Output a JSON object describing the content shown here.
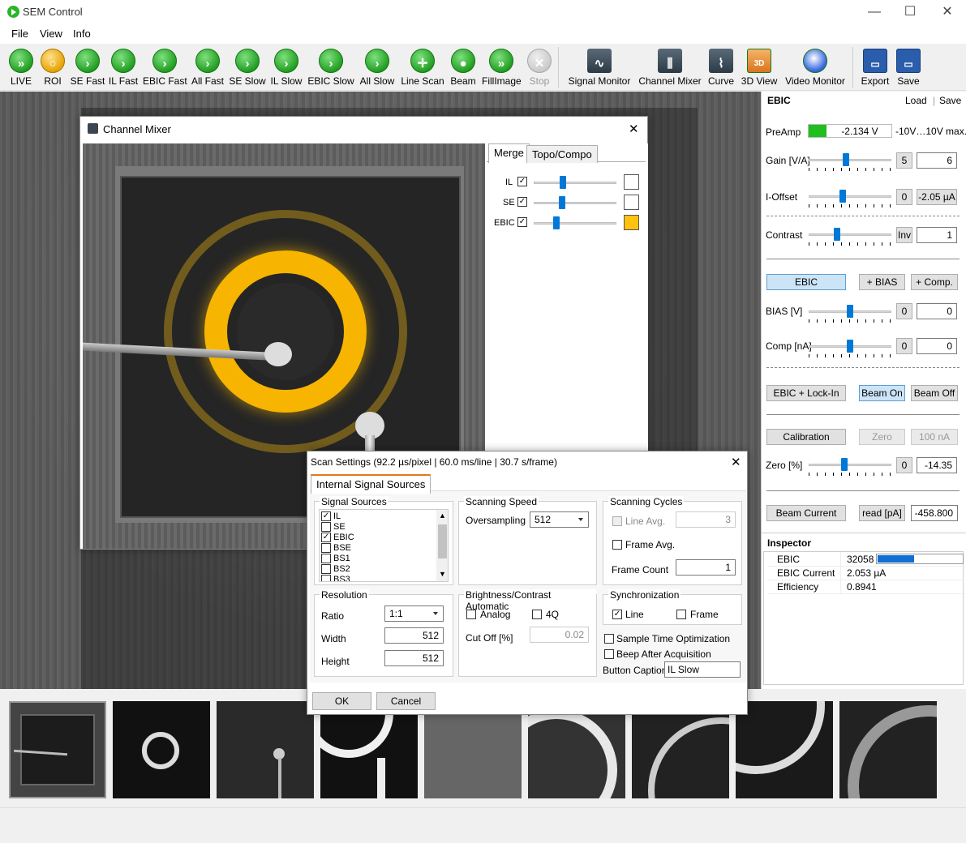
{
  "window": {
    "title": "SEM Control",
    "minimize": "—",
    "maximize": "☐",
    "close": "✕"
  },
  "menu": [
    "File",
    "View",
    "Info"
  ],
  "toolbar": {
    "run": [
      {
        "label": "LIVE",
        "icon": "live-icon"
      },
      {
        "label": "ROI",
        "icon": "roi-magnifier-icon"
      },
      {
        "label": "SE Fast",
        "icon": "play-icon"
      },
      {
        "label": "IL Fast",
        "icon": "play-icon"
      },
      {
        "label": "EBIC Fast",
        "icon": "play-icon"
      },
      {
        "label": "All Fast",
        "icon": "play-icon"
      },
      {
        "label": "SE Slow",
        "icon": "play-icon"
      },
      {
        "label": "IL Slow",
        "icon": "play-icon"
      },
      {
        "label": "EBIC Slow",
        "icon": "play-icon"
      },
      {
        "label": "All Slow",
        "icon": "play-icon"
      },
      {
        "label": "Line Scan",
        "icon": "line-scan-icon"
      },
      {
        "label": "Beam",
        "icon": "beam-icon"
      },
      {
        "label": "FillImage",
        "icon": "fill-image-icon"
      },
      {
        "label": "Stop",
        "icon": "stop-icon"
      }
    ],
    "tools": [
      {
        "label": "Signal Monitor",
        "icon": "signal-monitor-icon"
      },
      {
        "label": "Channel Mixer",
        "icon": "channel-mixer-icon"
      },
      {
        "label": "Curve",
        "icon": "curve-icon"
      },
      {
        "label": "3D View",
        "icon": "3d-view-icon"
      },
      {
        "label": "Video Monitor",
        "icon": "video-monitor-icon"
      }
    ],
    "file": [
      {
        "label": "Export",
        "icon": "floppy-disk-icon"
      },
      {
        "label": "Save",
        "icon": "floppy-disk-icon"
      }
    ]
  },
  "ebic_panel": {
    "title": "EBIC",
    "load": "Load",
    "save": "Save",
    "preamp_label": "PreAmp",
    "preamp_value": "-2.134 V",
    "preamp_range": "-10V…10V max.",
    "gain_label": "Gain [V/A]",
    "gain_step": "5",
    "gain_value": "6",
    "ioffset_label": "I-Offset",
    "ioffset_step": "0",
    "ioffset_value": "-2.05 µA",
    "contrast_label": "Contrast",
    "contrast_inv": "Inv",
    "contrast_value": "1",
    "btn_ebic": "EBIC",
    "btn_bias": "+ BIAS",
    "btn_comp": "+ Comp.",
    "bias_label": "BIAS [V]",
    "bias_step": "0",
    "bias_value": "0",
    "comp_label": "Comp [nA]",
    "comp_step": "0",
    "comp_value": "0",
    "btn_lockin": "EBIC + Lock-In",
    "btn_beam_on": "Beam On",
    "btn_beam_off": "Beam Off",
    "btn_calibration": "Calibration",
    "btn_zero": "Zero",
    "btn_100na": "100 nA",
    "zero_label": "Zero [%]",
    "zero_step": "0",
    "zero_value": "-14.35",
    "btn_beam_current": "Beam Current",
    "btn_read": "read [pA]",
    "beam_current_value": "-458.800"
  },
  "inspector": {
    "title": "Inspector",
    "rows": [
      {
        "name": "EBIC",
        "value": "32058",
        "bar": 0.4
      },
      {
        "name": "EBIC Current",
        "value": "2.053 µA"
      },
      {
        "name": "Efficiency",
        "value": "0.8941"
      }
    ]
  },
  "channel_mixer": {
    "title": "Channel Mixer",
    "close": "✕",
    "tabs": [
      "Merge",
      "Topo/Compo"
    ],
    "channels": [
      {
        "name": "IL",
        "checked": true,
        "level": 0.38,
        "color": "#ffffff"
      },
      {
        "name": "SE",
        "checked": true,
        "level": 0.36,
        "color": "#ffffff"
      },
      {
        "name": "EBIC",
        "checked": true,
        "level": 0.27,
        "color": "#ffc20e"
      }
    ]
  },
  "scan_settings": {
    "title": "Scan Settings (92.2 µs/pixel | 60.0 ms/line | 30.7 s/frame)",
    "close": "✕",
    "tab": "Internal Signal Sources",
    "signal_sources_title": "Signal Sources",
    "sources": [
      {
        "name": "IL",
        "checked": true
      },
      {
        "name": "SE",
        "checked": false
      },
      {
        "name": "EBIC",
        "checked": true
      },
      {
        "name": "BSE",
        "checked": false
      },
      {
        "name": "BS1",
        "checked": false
      },
      {
        "name": "BS2",
        "checked": false
      },
      {
        "name": "BS3",
        "checked": false
      }
    ],
    "scanning_speed_title": "Scanning Speed",
    "oversampling_label": "Oversampling",
    "oversampling_value": "512",
    "scanning_cycles_title": "Scanning Cycles",
    "line_avg_label": "Line Avg.",
    "line_avg_value": "3",
    "frame_avg_label": "Frame Avg.",
    "frame_count_label": "Frame Count",
    "frame_count_value": "1",
    "resolution_title": "Resolution",
    "ratio_label": "Ratio",
    "ratio_value": "1:1",
    "width_label": "Width",
    "width_value": "512",
    "height_label": "Height",
    "height_value": "512",
    "bc_title": "Brightness/Contrast Automatic",
    "analog_label": "Analog",
    "q4_label": "4Q",
    "cutoff_label": "Cut Off [%]",
    "cutoff_value": "0.02",
    "sync_title": "Synchronization",
    "sync_line": "Line",
    "sync_frame": "Frame",
    "sample_time_label": "Sample Time Optimization",
    "beep_label": "Beep After Acquisition",
    "caption_label": "Button Caption",
    "caption_value": "IL Slow",
    "ok": "OK",
    "cancel": "Cancel"
  }
}
